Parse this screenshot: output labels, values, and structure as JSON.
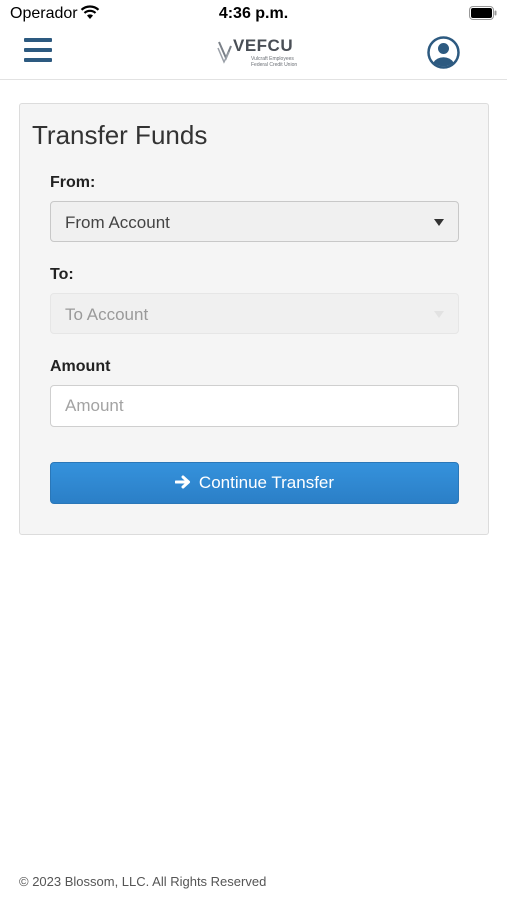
{
  "status_bar": {
    "carrier": "Operador",
    "time": "4:36 p.m."
  },
  "header": {
    "logo": {
      "name": "VEFCU",
      "line1": "Vulcraft Employees",
      "line2": "Federal Credit Union"
    },
    "menu_icon": "hamburger-icon",
    "profile_icon": "user-circle-icon"
  },
  "transfer": {
    "title": "Transfer Funds",
    "from_label": "From:",
    "from_value": "From Account",
    "to_label": "To:",
    "to_value": "To Account",
    "amount_label": "Amount",
    "amount_placeholder": "Amount",
    "continue_label": "Continue Transfer"
  },
  "footer": {
    "copyright": "© 2023 Blossom, LLC. All Rights Reserved"
  },
  "colors": {
    "brand": "#2d5a80",
    "primary_button": "#2b7fc7"
  }
}
